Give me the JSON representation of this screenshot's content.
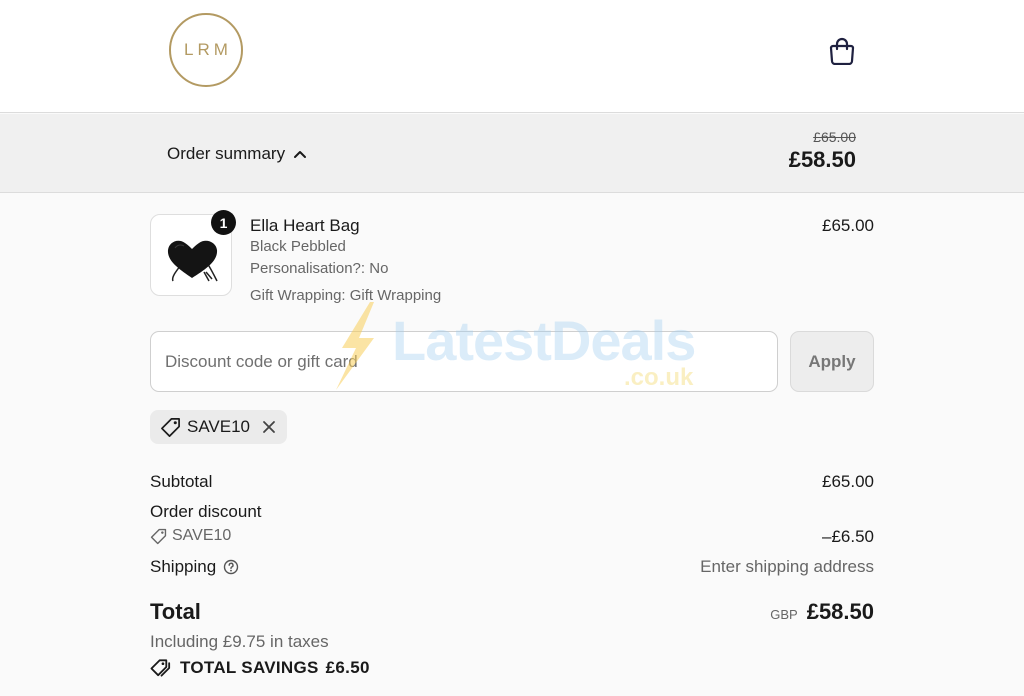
{
  "header": {
    "logo_text": "LRM",
    "logo_color": "#b39a62",
    "cart_icon": "shopping-bag-icon"
  },
  "summary": {
    "toggle_label": "Order summary",
    "toggle_icon": "chevron-up-icon",
    "original_price": "£65.00",
    "current_price": "£58.50"
  },
  "product": {
    "quantity": "1",
    "name": "Ella Heart Bag",
    "variant": "Black Pebbled",
    "personalisation": "Personalisation?: No",
    "gift_wrapping": "Gift Wrapping: Gift Wrapping",
    "price": "£65.00"
  },
  "discount": {
    "placeholder": "Discount code or gift card",
    "apply_label": "Apply",
    "applied_code": "SAVE10"
  },
  "watermark": {
    "brand": "LatestDeals",
    "domain": ".co.uk"
  },
  "totals": {
    "subtotal_label": "Subtotal",
    "subtotal_value": "£65.00",
    "order_discount_label": "Order discount",
    "discount_code": "SAVE10",
    "discount_value": "–£6.50",
    "shipping_label": "Shipping",
    "shipping_value": "Enter shipping address",
    "total_label": "Total",
    "currency": "GBP",
    "total_value": "£58.50",
    "taxes_note": "Including £9.75 in taxes",
    "savings_label": "TOTAL SAVINGS",
    "savings_value": "£6.50"
  }
}
